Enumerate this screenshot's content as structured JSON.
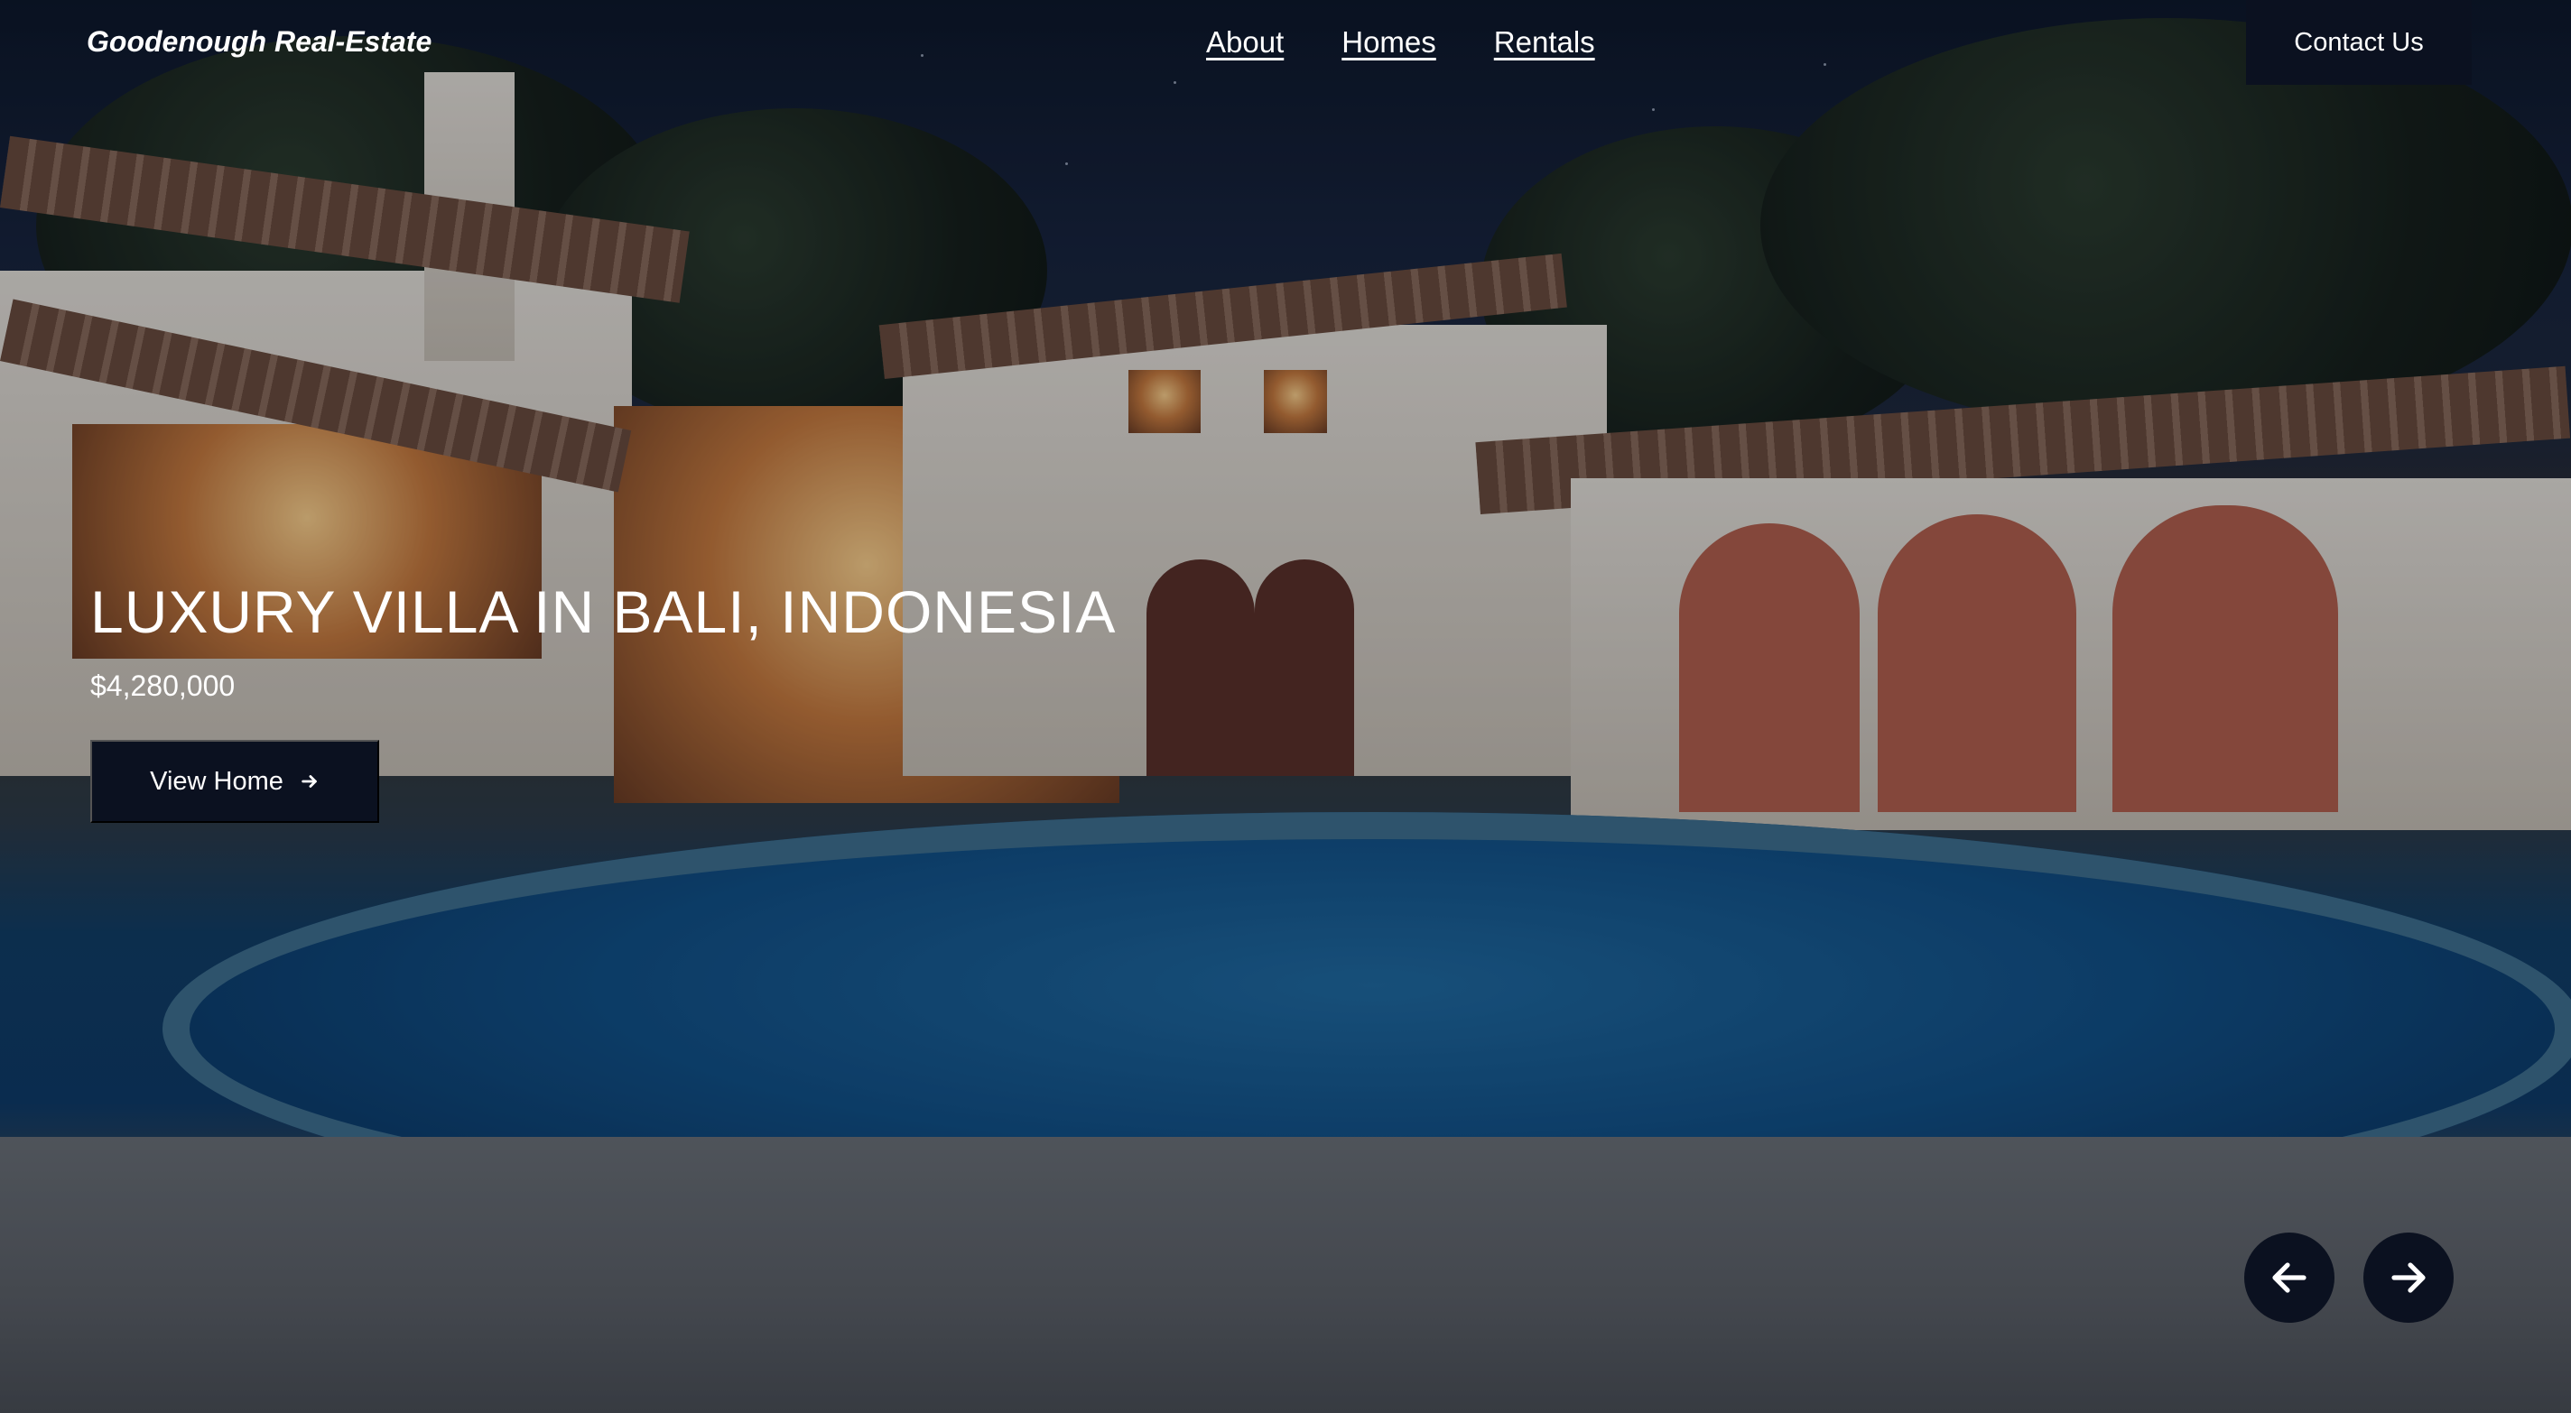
{
  "header": {
    "brand": "Goodenough Real-Estate",
    "nav": [
      "About",
      "Homes",
      "Rentals"
    ],
    "contact_label": "Contact Us"
  },
  "listing": {
    "title": "LUXURY VILLA IN BALI, INDONESIA",
    "price": "$4,280,000",
    "view_label": "View Home"
  },
  "carousel": {
    "prev_icon": "arrow-left-icon",
    "next_icon": "arrow-right-icon"
  },
  "colors": {
    "button_bg": "#0b1120",
    "text": "#ffffff"
  }
}
